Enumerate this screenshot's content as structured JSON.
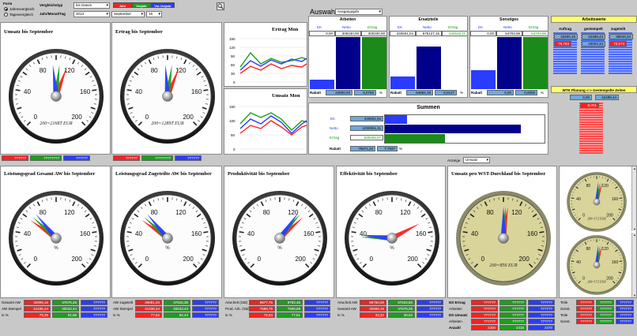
{
  "toolbar": {
    "form_label": "Form",
    "radio1": "Jahresvergleich",
    "radio2": "Tagesvergleich",
    "vergleich_label": "Vergleichstyp",
    "vergleich_value": "bis Datum",
    "jmt_label": "Jahr/Monat/Tag",
    "year_value": "2013",
    "month_value": "September",
    "day_value": "16",
    "legend": [
      "Jahr",
      "Vorjahr",
      "Vor-Vorjahr"
    ],
    "legend_colors": [
      "#ff2020",
      "#1aa01a",
      "#2a3cff"
    ],
    "icon": "magnifier-icon"
  },
  "gauge1": {
    "title": "Umsatz bis September",
    "readout": "200=2168T EUR",
    "ticks": [
      "0",
      "40",
      "80",
      "120",
      "160",
      "200"
    ],
    "values": [
      "??????",
      "????????",
      "??????"
    ]
  },
  "gauge2": {
    "title": "Ertrag bis September",
    "readout": "200=1289T EUR",
    "ticks": [
      "0",
      "40",
      "80",
      "120",
      "160",
      "200"
    ],
    "values": [
      "??????",
      "????????",
      "??????"
    ]
  },
  "minichart1": {
    "title": "Ertrag Mon",
    "yticks": [
      "150",
      "120",
      "90",
      "60",
      "30",
      "0"
    ]
  },
  "minichart2": {
    "title": "Umsatz Mon",
    "yticks": [
      "150",
      "100",
      "50",
      "0"
    ]
  },
  "auswahl": {
    "label": "Auswahl",
    "value": "Ausgangsjahr"
  },
  "arbeiten": {
    "title": "Arbeiten",
    "cols": [
      "EK",
      "Netto",
      "Ertrag"
    ],
    "vals": [
      "0,00",
      "300230,00",
      "300230,00"
    ],
    "rabatt_label": "Rabatt",
    "rabatt1": "24900,03",
    "rabatt2": "9,0766",
    "pct": "%"
  },
  "ersatzteile": {
    "title": "Ersatzteile",
    "cols": [
      "EK",
      "Netto",
      "Ertrag"
    ],
    "vals": [
      "440601,04",
      "675127,15",
      "234526,11"
    ],
    "rabatt_label": "Rabatt",
    "rabatt1": "54684,19",
    "rabatt2": "8,0137",
    "pct": "%"
  },
  "sonstiges": {
    "title": "Sonstiges",
    "cols": [
      "EK",
      "Netto",
      "Ertrag"
    ],
    "vals": [
      "0,00",
      "54703,96",
      "54703,96"
    ],
    "rabatt_label": "Rabatt",
    "rabatt1": "0,00",
    "rabatt2": "0,0000",
    "pct": "%"
  },
  "arbeitswerte": {
    "title": "Arbeitswerte",
    "cols": [
      "Auftrag",
      "gestempelt",
      "zugeteilt"
    ],
    "vals": [
      "33250,15",
      "42499,44",
      "38043,34"
    ],
    "vals2": [
      "76,764",
      "40003,34",
      "72,674"
    ]
  },
  "wtk": {
    "title": "WTK Planung <-> Gestempelte Zeiten",
    "v1": "0,00",
    "v2": "42499,44",
    "pct": "-0,001"
  },
  "summen": {
    "title": "Summen",
    "rows": [
      "EK",
      "Netto",
      "Ertrag"
    ],
    "vals": [
      "440601,04",
      "1030061,11",
      "589459,07"
    ],
    "rabatt_label": "Rabatt",
    "rabatt1": "79671,22",
    "rabatt2": "7,7937",
    "pct": "%"
  },
  "anzeige": {
    "label": "Anzeige",
    "value": "Umsatz"
  },
  "gauge3": {
    "title": "Leistungsgrad Gesamt AW bis September",
    "unit": "%",
    "ticks": [
      "0",
      "40",
      "80",
      "120",
      "160",
      "200"
    ]
  },
  "gauge4": {
    "title": "Leistungsgrad Zugeteilte AW bis September",
    "unit": "%",
    "ticks": [
      "0",
      "40",
      "80",
      "120",
      "160",
      "200"
    ]
  },
  "gauge5": {
    "title": "Produktivität bis September",
    "unit": "%",
    "ticks": [
      "0",
      "40",
      "80",
      "120",
      "160",
      "200"
    ]
  },
  "gauge6": {
    "title": "Effektivität bis September",
    "unit": "%",
    "ticks": [
      "0",
      "40",
      "80",
      "120",
      "160",
      "200"
    ]
  },
  "gauge7": {
    "title": "Umsatz pro WST-Durchlauf bis September",
    "readout": "200=856 EUR",
    "ticks": [
      "0",
      "40",
      "80",
      "120",
      "160",
      "200"
    ]
  },
  "gauge8": {
    "readout": "200=17,5 EUR",
    "ticks": [
      "0",
      "40",
      "80",
      "120",
      "160",
      "200"
    ]
  },
  "gauge9": {
    "readout": "200=17,5 EUR",
    "ticks": [
      "0",
      "40",
      "80",
      "120",
      "160",
      "200"
    ]
  },
  "table3": {
    "rows": [
      {
        "label": "Gesamt AW",
        "v": [
          "32906,15",
          "37675,25",
          "??????"
        ]
      },
      {
        "label": "AW Stempel",
        "v": [
          "41436,44",
          "40043,44",
          "??????"
        ]
      },
      {
        "label": "in %",
        "v": [
          "79,39",
          "91,88",
          "??????"
        ]
      }
    ]
  },
  "table4": {
    "rows": [
      {
        "label": "AW zugeteilt",
        "v": [
          "36851,34",
          "37815,35",
          "??????"
        ]
      },
      {
        "label": "AW Stempel",
        "v": [
          "41436,44",
          "40043,44",
          "??????"
        ]
      },
      {
        "label": "in %",
        "v": [
          "77,52",
          "94,44",
          "??????"
        ]
      }
    ]
  },
  "table5": {
    "rows": [
      {
        "label": "Anw.heit (Std)",
        "v": [
          "9877,75",
          "9793,45",
          "??????"
        ]
      },
      {
        "label": "Prod. Arb. (Std)",
        "v": [
          "7589,75",
          "7590,69",
          "??????"
        ]
      },
      {
        "label": "in %",
        "v": [
          "76,83",
          "77,51",
          "??????"
        ]
      }
    ]
  },
  "table6": {
    "rows": [
      {
        "label": "Anw.heit AW",
        "v": [
          "98750,00",
          "97534,50",
          "??????"
        ]
      },
      {
        "label": "Gesamt AW",
        "v": [
          "32906,15",
          "37675,25",
          "??????"
        ]
      },
      {
        "label": "in %",
        "v": [
          "33,32",
          "38,63",
          "??????"
        ]
      }
    ]
  },
  "table7": {
    "rows": [
      {
        "label": "DS Ertrag",
        "v": [
          "??????",
          "??????",
          "??????"
        ],
        "bold": true
      },
      {
        "label": "Arbeiten",
        "v": [
          "??????",
          "??????",
          "??????"
        ]
      },
      {
        "label": "DS Umsatz",
        "v": [
          "??????",
          "??????",
          "??????"
        ],
        "bold": true
      },
      {
        "label": "Arbeiten",
        "v": [
          "??????",
          "??????",
          "??????"
        ]
      },
      {
        "label": "Anzahl",
        "v": [
          "2300",
          "2415",
          "2470"
        ],
        "bold": true
      }
    ]
  },
  "table8": {
    "rows": [
      {
        "label": "Teile",
        "v": [
          "??????",
          "??????",
          "??????"
        ]
      },
      {
        "label": "Sonst.",
        "v": [
          "??????",
          "??????",
          "??????"
        ]
      },
      {
        "label": "Teile",
        "v": [
          "??????",
          "??????",
          "??????"
        ]
      },
      {
        "label": "Sonst.",
        "v": [
          "??????",
          "??????",
          "??????"
        ]
      }
    ]
  }
}
